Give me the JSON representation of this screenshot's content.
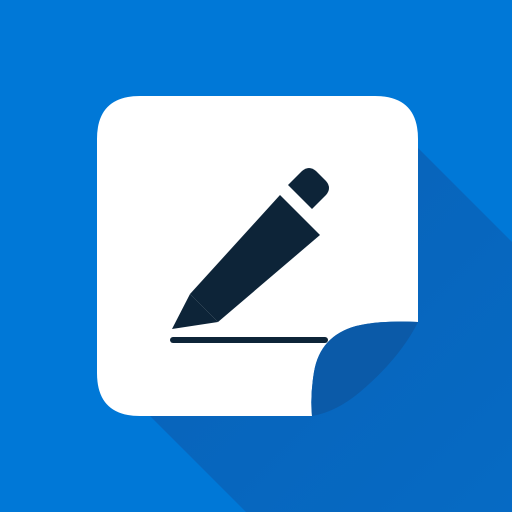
{
  "app_icon": {
    "icon": "note-edit-icon",
    "parts": {
      "note": "sticky-note-icon",
      "pencil": "pencil-icon",
      "curl": "page-curl-icon"
    },
    "colors": {
      "background": "#0078D7",
      "shadow": "#0A62B8",
      "note": "#FFFFFF",
      "pencil": "#0D2438",
      "curl": "#0B5AA8"
    }
  }
}
